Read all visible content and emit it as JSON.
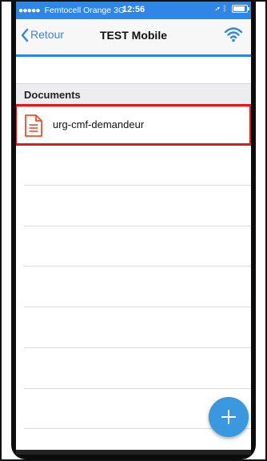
{
  "status_bar": {
    "carrier": "Femtocell Orange",
    "network": "3G",
    "time": "12:56"
  },
  "nav": {
    "back_label": "Retour",
    "title": "TEST Mobile"
  },
  "section": {
    "title": "Documents"
  },
  "documents": [
    {
      "name": "urg-cmf-demandeur",
      "icon": "document-icon",
      "highlighted": true
    }
  ],
  "colors": {
    "accent": "#2e86e6",
    "fab": "#3a98df",
    "highlight": "#e81717",
    "doc_icon": "#e9512f"
  }
}
